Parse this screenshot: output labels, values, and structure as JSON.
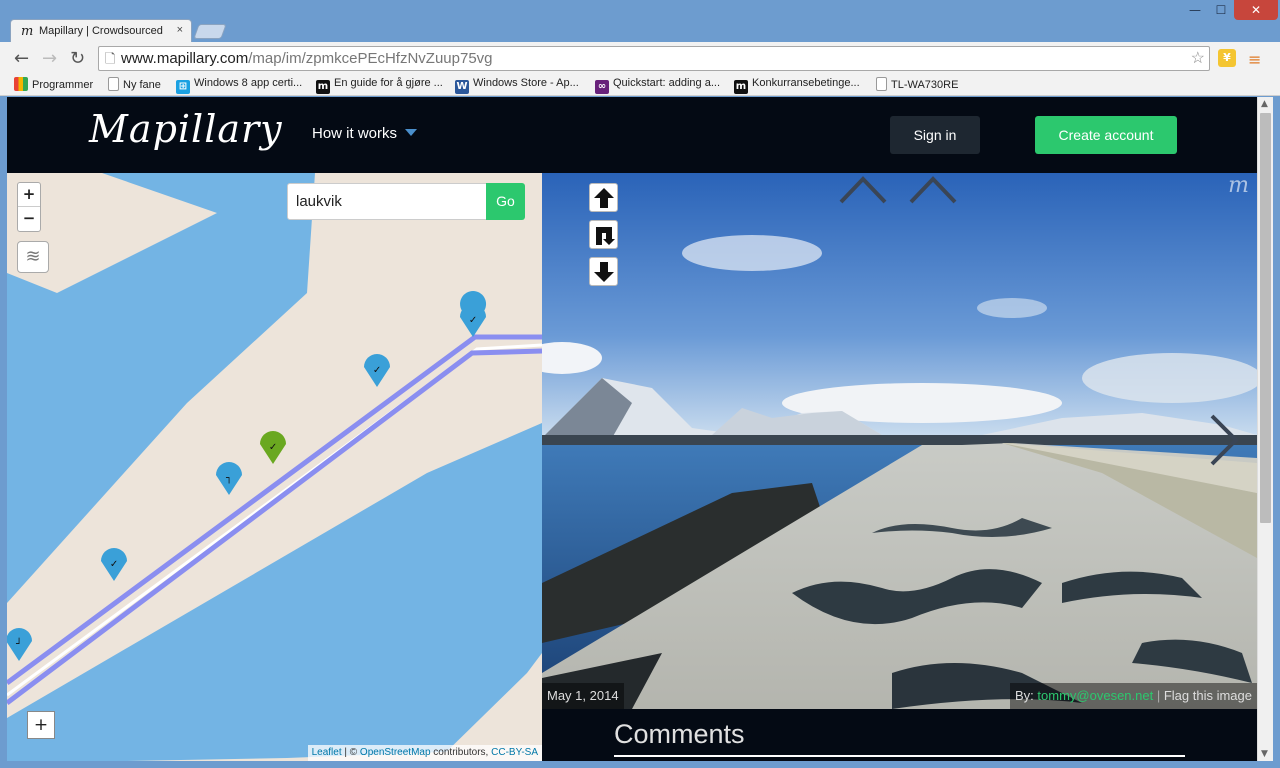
{
  "browser": {
    "tab_title": "Mapillary | Crowdsourced",
    "tab_favicon": "m",
    "tab_close": "×",
    "window_controls": {
      "minimize": "—",
      "maximize": "☐",
      "close": "✕"
    },
    "url_host": "www.mapillary.com",
    "url_path": "/map/im/zpmkcePEcHfzNvZuup75vg",
    "bookmarks": [
      {
        "label": "Programmer",
        "icon": "apps-grid-icon"
      },
      {
        "label": "Ny fane",
        "icon": "page-icon"
      },
      {
        "label": "Windows 8 app certi...",
        "icon": "windows-logo-icon"
      },
      {
        "label": "En guide for å gjøre ...",
        "icon": "m-logo-icon"
      },
      {
        "label": "Windows Store - Ap...",
        "icon": "word-doc-icon"
      },
      {
        "label": "Quickstart: adding a...",
        "icon": "visual-studio-icon"
      },
      {
        "label": "Konkurransebetinge...",
        "icon": "m-logo-icon"
      },
      {
        "label": "TL-WA730RE",
        "icon": "page-icon"
      }
    ]
  },
  "site": {
    "logo": "Mapillary",
    "nav_how_it_works": "How it works",
    "sign_in": "Sign in",
    "create_account": "Create account"
  },
  "map": {
    "search_value": "laukvik",
    "go_label": "Go",
    "zoom_in": "+",
    "zoom_out": "−",
    "plus_button": "+",
    "attribution": {
      "leaflet": "Leaflet",
      "sep1": " | © ",
      "osm": "OpenStreetMap",
      "contributors": " contributors, ",
      "license": "CC-BY-SA"
    }
  },
  "photo": {
    "date": "May 1, 2014",
    "by_label": "By: ",
    "user": "tommy@ovesen.net",
    "separator": " | ",
    "flag": "Flag this image",
    "watermark": "m"
  },
  "comments": {
    "heading": "Comments"
  },
  "colors": {
    "brand_green": "#2cc86e",
    "header_bg": "#040a14",
    "water": "#73b4e4",
    "land": "#ede4da",
    "route": "#8a8ef0",
    "marker_blue": "#3aa0d8",
    "marker_active": "#6aa820"
  }
}
